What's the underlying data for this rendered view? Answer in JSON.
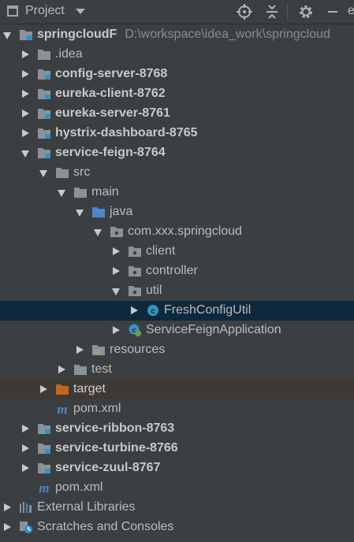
{
  "header": {
    "title": "Project",
    "locate_icon": "crosshair-icon",
    "collapse_icon": "collapse-all-icon",
    "settings_icon": "gear-icon",
    "hide_icon": "minimize-icon",
    "cut_text": "e"
  },
  "colors": {
    "background": "#3c3f41",
    "selected_row": "#0d293e",
    "excluded_row": "#3d3935",
    "folder": "#8a9299",
    "source_folder": "#4a88c7",
    "target_folder": "#c7651e",
    "module_badge": "#3592c4"
  },
  "tree": [
    {
      "label": "springcloudF",
      "path": "D:\\workspace\\idea_work\\springcloud",
      "icon": "module-folder-icon",
      "expander": "open",
      "bold": true
    },
    {
      "label": ".idea",
      "icon": "folder-icon",
      "expander": "closed",
      "bold": false
    },
    {
      "label": "config-server-8768",
      "icon": "module-folder-icon",
      "expander": "closed",
      "bold": true
    },
    {
      "label": "eureka-client-8762",
      "icon": "module-folder-icon",
      "expander": "closed",
      "bold": true
    },
    {
      "label": "eureka-server-8761",
      "icon": "module-folder-icon",
      "expander": "closed",
      "bold": true
    },
    {
      "label": "hystrix-dashboard-8765",
      "icon": "module-folder-icon",
      "expander": "closed",
      "bold": true
    },
    {
      "label": "service-feign-8764",
      "icon": "module-folder-icon",
      "expander": "open",
      "bold": true
    },
    {
      "label": "src",
      "icon": "folder-icon",
      "expander": "open",
      "bold": false
    },
    {
      "label": "main",
      "icon": "folder-icon",
      "expander": "open",
      "bold": false
    },
    {
      "label": "java",
      "icon": "source-folder-icon",
      "expander": "open",
      "bold": false
    },
    {
      "label": "com.xxx.springcloud",
      "icon": "package-icon",
      "expander": "open",
      "bold": false
    },
    {
      "label": "client",
      "icon": "package-icon",
      "expander": "closed",
      "bold": false
    },
    {
      "label": "controller",
      "icon": "package-icon",
      "expander": "closed",
      "bold": false
    },
    {
      "label": "util",
      "icon": "package-icon",
      "expander": "open",
      "bold": false
    },
    {
      "label": "FreshConfigUtil",
      "icon": "class-icon",
      "expander": "closed",
      "bold": false,
      "selected": true
    },
    {
      "label": "ServiceFeignApplication",
      "icon": "spring-boot-class-icon",
      "expander": "closed",
      "bold": false
    },
    {
      "label": "resources",
      "icon": "resources-folder-icon",
      "expander": "closed",
      "bold": false
    },
    {
      "label": "test",
      "icon": "folder-icon",
      "expander": "closed",
      "bold": false
    },
    {
      "label": "target",
      "icon": "excluded-folder-icon",
      "expander": "closed",
      "bold": false,
      "excluded": true
    },
    {
      "label": "pom.xml",
      "icon": "maven-icon",
      "expander": "none",
      "bold": false
    },
    {
      "label": "service-ribbon-8763",
      "icon": "module-folder-icon",
      "expander": "closed",
      "bold": true
    },
    {
      "label": "service-turbine-8766",
      "icon": "module-folder-icon",
      "expander": "closed",
      "bold": true
    },
    {
      "label": "service-zuul-8767",
      "icon": "module-folder-icon",
      "expander": "closed",
      "bold": true
    },
    {
      "label": "pom.xml",
      "icon": "maven-icon",
      "expander": "none",
      "bold": false
    },
    {
      "label": "External Libraries",
      "icon": "libraries-icon",
      "expander": "closed",
      "bold": false
    },
    {
      "label": "Scratches and Consoles",
      "icon": "scratches-icon",
      "expander": "closed",
      "bold": false
    }
  ]
}
